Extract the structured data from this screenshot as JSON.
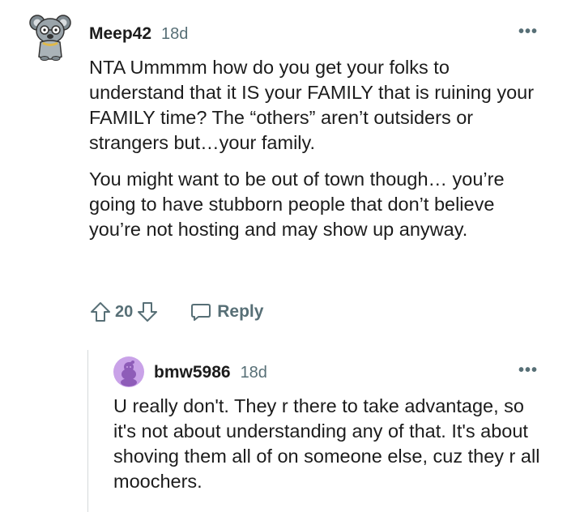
{
  "comment": {
    "username": "Meep42",
    "timestamp": "18d",
    "avatar_icon": "koala-avatar-icon",
    "paragraphs": [
      "NTA Ummmm how do you get your folks to understand that it IS your FAMILY that is ruining your FAMILY time? The “others” aren’t outsiders or strangers but…your family.",
      "You might want to be out of town though… you’re going to have stubborn people that don’t believe you’re not hosting and may show up anyway."
    ],
    "vote_count": "20",
    "reply_label": "Reply",
    "more_label": "•••"
  },
  "reply": {
    "username": "bmw5986",
    "timestamp": "18d",
    "avatar_icon": "snoo-avatar-icon",
    "avatar_color": "#c9a2e8",
    "paragraphs": [
      "U really don't. They r there to take advantage, so it's not about understanding any of that. It's about shoving them all of on someone else, cuz they r all moochers."
    ],
    "more_label": "•••"
  }
}
